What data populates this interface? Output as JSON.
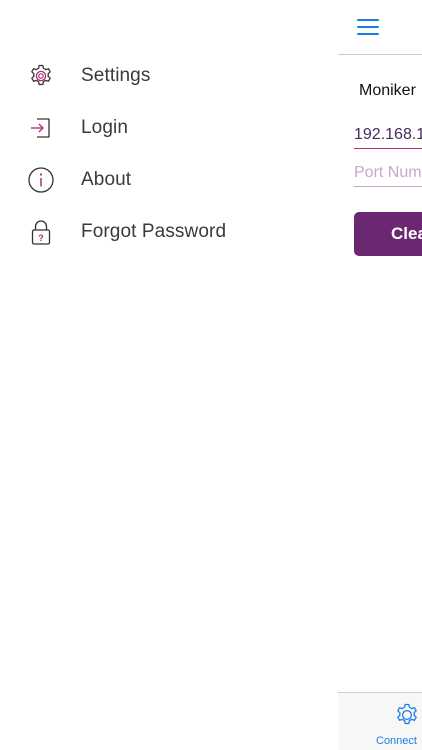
{
  "drawer": {
    "items": [
      {
        "label": "Settings",
        "icon": "gear-icon"
      },
      {
        "label": "Login",
        "icon": "login-icon"
      },
      {
        "label": "About",
        "icon": "info-icon"
      },
      {
        "label": "Forgot Password",
        "icon": "lock-question-icon"
      }
    ]
  },
  "main": {
    "menu_icon": "hamburger-icon",
    "moniker_label": "Moniker",
    "ip_value": "192.168.1",
    "port_placeholder": "Port Num",
    "clear_button_label": "Clea"
  },
  "tabbar": {
    "tabs": [
      {
        "label": "Connect",
        "icon": "gear-icon"
      }
    ]
  },
  "colors": {
    "accent_purple": "#6b2872",
    "icon_magenta": "#b02c7a",
    "ios_blue": "#1a7de6",
    "text_dark": "#3a3a3a"
  }
}
